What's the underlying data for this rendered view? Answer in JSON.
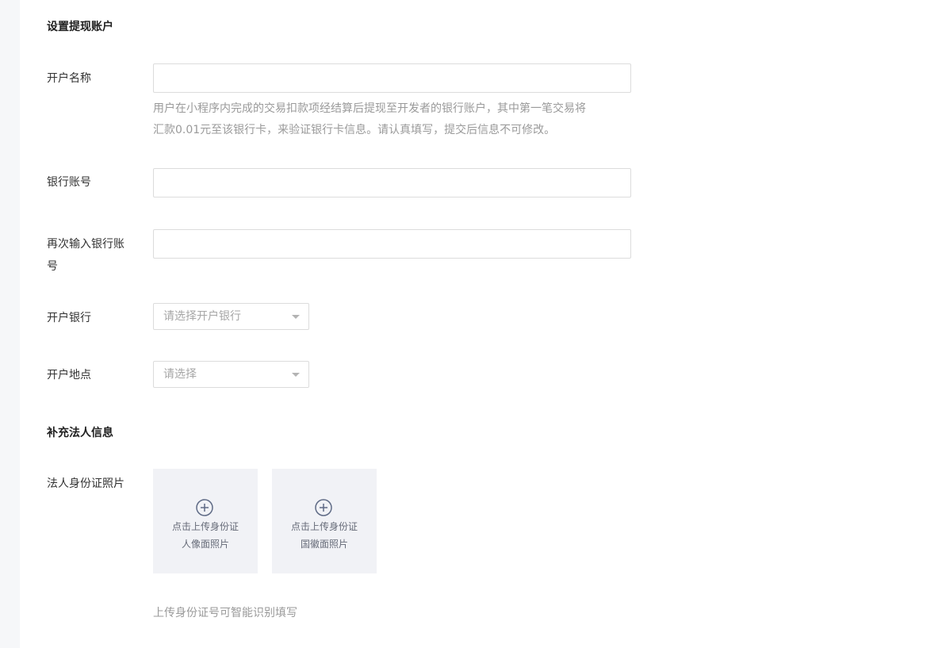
{
  "sections": {
    "withdraw_account_title": "设置提现账户",
    "legal_person_title": "补充法人信息"
  },
  "account_name": {
    "label": "开户名称",
    "value": "",
    "placeholder": "",
    "hint_line1": "用户在小程序内完成的交易扣款项经结算后提现至开发者的银行账户，其中第一笔交易将",
    "hint_line2": "汇款0.01元至该银行卡，来验证银行卡信息。请认真填写，提交后信息不可修改。"
  },
  "bank_account": {
    "label": "银行账号",
    "value": "",
    "placeholder": ""
  },
  "bank_account_confirm": {
    "label_line1": "再次输入银行账",
    "label_line2": "号",
    "value": "",
    "placeholder": ""
  },
  "bank": {
    "label": "开户银行",
    "placeholder": "请选择开户银行"
  },
  "location": {
    "label": "开户地点",
    "placeholder": "请选择"
  },
  "id_photo": {
    "label": "法人身份证照片",
    "portrait_line1": "点击上传身份证",
    "portrait_line2": "人像面照片",
    "emblem_line1": "点击上传身份证",
    "emblem_line2": "国徽面照片",
    "plus_icon": "plus-circle-icon",
    "footer_hint": "上传身份证号可智能识别填写"
  },
  "colors": {
    "rail": "#f6f7f9",
    "card_bg": "#f1f2f6",
    "border": "#dcdcdc",
    "hint": "#9a9a9a"
  }
}
